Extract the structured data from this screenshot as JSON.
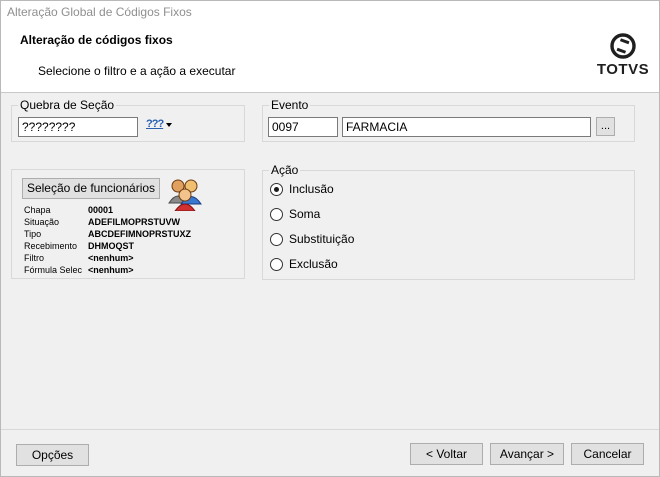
{
  "window": {
    "title": "Alteração Global de Códigos Fixos"
  },
  "header": {
    "title": "Alteração de códigos fixos",
    "subtitle": "Selecione o filtro e a ação a executar",
    "logo_text": "TOTVS"
  },
  "quebra": {
    "legend": "Quebra de Seção",
    "value": "????????",
    "dropdown_label": "???"
  },
  "evento": {
    "legend": "Evento",
    "code": "0097",
    "name": "FARMACIA",
    "browse_label": "..."
  },
  "selecao": {
    "button_label": "Seleção de funcionários",
    "rows": [
      {
        "label": "Chapa",
        "value": "00001"
      },
      {
        "label": "Situação",
        "value": "ADEFILMOPRSTUVW"
      },
      {
        "label": "Tipo",
        "value": "ABCDEFIMNOPRSTUXZ"
      },
      {
        "label": "Recebimento",
        "value": "DHMOQST"
      },
      {
        "label": "Filtro",
        "value": "<nenhum>"
      },
      {
        "label": "Fórmula Selec",
        "value": "<nenhum>"
      }
    ]
  },
  "acao": {
    "legend": "Ação",
    "selected": "Inclusão",
    "options": [
      "Inclusão",
      "Soma",
      "Substituição",
      "Exclusão"
    ]
  },
  "footer": {
    "options_label": "Opções",
    "back_label": "< Voltar",
    "next_label": "Avançar >",
    "cancel_label": "Cancelar"
  }
}
